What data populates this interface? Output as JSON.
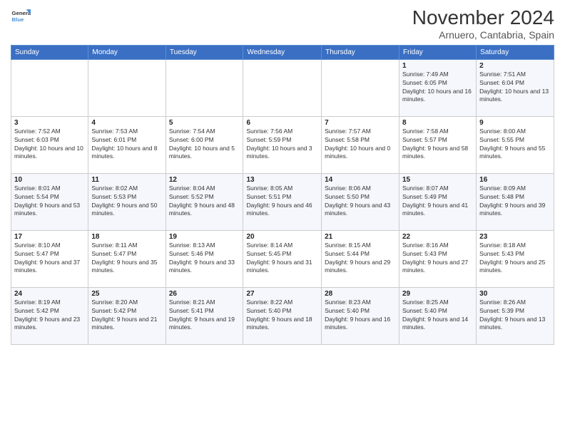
{
  "logo": {
    "line1": "General",
    "line2": "Blue"
  },
  "header": {
    "month": "November 2024",
    "location": "Arnuero, Cantabria, Spain"
  },
  "weekdays": [
    "Sunday",
    "Monday",
    "Tuesday",
    "Wednesday",
    "Thursday",
    "Friday",
    "Saturday"
  ],
  "weeks": [
    [
      {
        "day": "",
        "info": ""
      },
      {
        "day": "",
        "info": ""
      },
      {
        "day": "",
        "info": ""
      },
      {
        "day": "",
        "info": ""
      },
      {
        "day": "",
        "info": ""
      },
      {
        "day": "1",
        "info": "Sunrise: 7:49 AM\nSunset: 6:05 PM\nDaylight: 10 hours and 16 minutes."
      },
      {
        "day": "2",
        "info": "Sunrise: 7:51 AM\nSunset: 6:04 PM\nDaylight: 10 hours and 13 minutes."
      }
    ],
    [
      {
        "day": "3",
        "info": "Sunrise: 7:52 AM\nSunset: 6:03 PM\nDaylight: 10 hours and 10 minutes."
      },
      {
        "day": "4",
        "info": "Sunrise: 7:53 AM\nSunset: 6:01 PM\nDaylight: 10 hours and 8 minutes."
      },
      {
        "day": "5",
        "info": "Sunrise: 7:54 AM\nSunset: 6:00 PM\nDaylight: 10 hours and 5 minutes."
      },
      {
        "day": "6",
        "info": "Sunrise: 7:56 AM\nSunset: 5:59 PM\nDaylight: 10 hours and 3 minutes."
      },
      {
        "day": "7",
        "info": "Sunrise: 7:57 AM\nSunset: 5:58 PM\nDaylight: 10 hours and 0 minutes."
      },
      {
        "day": "8",
        "info": "Sunrise: 7:58 AM\nSunset: 5:57 PM\nDaylight: 9 hours and 58 minutes."
      },
      {
        "day": "9",
        "info": "Sunrise: 8:00 AM\nSunset: 5:55 PM\nDaylight: 9 hours and 55 minutes."
      }
    ],
    [
      {
        "day": "10",
        "info": "Sunrise: 8:01 AM\nSunset: 5:54 PM\nDaylight: 9 hours and 53 minutes."
      },
      {
        "day": "11",
        "info": "Sunrise: 8:02 AM\nSunset: 5:53 PM\nDaylight: 9 hours and 50 minutes."
      },
      {
        "day": "12",
        "info": "Sunrise: 8:04 AM\nSunset: 5:52 PM\nDaylight: 9 hours and 48 minutes."
      },
      {
        "day": "13",
        "info": "Sunrise: 8:05 AM\nSunset: 5:51 PM\nDaylight: 9 hours and 46 minutes."
      },
      {
        "day": "14",
        "info": "Sunrise: 8:06 AM\nSunset: 5:50 PM\nDaylight: 9 hours and 43 minutes."
      },
      {
        "day": "15",
        "info": "Sunrise: 8:07 AM\nSunset: 5:49 PM\nDaylight: 9 hours and 41 minutes."
      },
      {
        "day": "16",
        "info": "Sunrise: 8:09 AM\nSunset: 5:48 PM\nDaylight: 9 hours and 39 minutes."
      }
    ],
    [
      {
        "day": "17",
        "info": "Sunrise: 8:10 AM\nSunset: 5:47 PM\nDaylight: 9 hours and 37 minutes."
      },
      {
        "day": "18",
        "info": "Sunrise: 8:11 AM\nSunset: 5:47 PM\nDaylight: 9 hours and 35 minutes."
      },
      {
        "day": "19",
        "info": "Sunrise: 8:13 AM\nSunset: 5:46 PM\nDaylight: 9 hours and 33 minutes."
      },
      {
        "day": "20",
        "info": "Sunrise: 8:14 AM\nSunset: 5:45 PM\nDaylight: 9 hours and 31 minutes."
      },
      {
        "day": "21",
        "info": "Sunrise: 8:15 AM\nSunset: 5:44 PM\nDaylight: 9 hours and 29 minutes."
      },
      {
        "day": "22",
        "info": "Sunrise: 8:16 AM\nSunset: 5:43 PM\nDaylight: 9 hours and 27 minutes."
      },
      {
        "day": "23",
        "info": "Sunrise: 8:18 AM\nSunset: 5:43 PM\nDaylight: 9 hours and 25 minutes."
      }
    ],
    [
      {
        "day": "24",
        "info": "Sunrise: 8:19 AM\nSunset: 5:42 PM\nDaylight: 9 hours and 23 minutes."
      },
      {
        "day": "25",
        "info": "Sunrise: 8:20 AM\nSunset: 5:42 PM\nDaylight: 9 hours and 21 minutes."
      },
      {
        "day": "26",
        "info": "Sunrise: 8:21 AM\nSunset: 5:41 PM\nDaylight: 9 hours and 19 minutes."
      },
      {
        "day": "27",
        "info": "Sunrise: 8:22 AM\nSunset: 5:40 PM\nDaylight: 9 hours and 18 minutes."
      },
      {
        "day": "28",
        "info": "Sunrise: 8:23 AM\nSunset: 5:40 PM\nDaylight: 9 hours and 16 minutes."
      },
      {
        "day": "29",
        "info": "Sunrise: 8:25 AM\nSunset: 5:40 PM\nDaylight: 9 hours and 14 minutes."
      },
      {
        "day": "30",
        "info": "Sunrise: 8:26 AM\nSunset: 5:39 PM\nDaylight: 9 hours and 13 minutes."
      }
    ]
  ]
}
